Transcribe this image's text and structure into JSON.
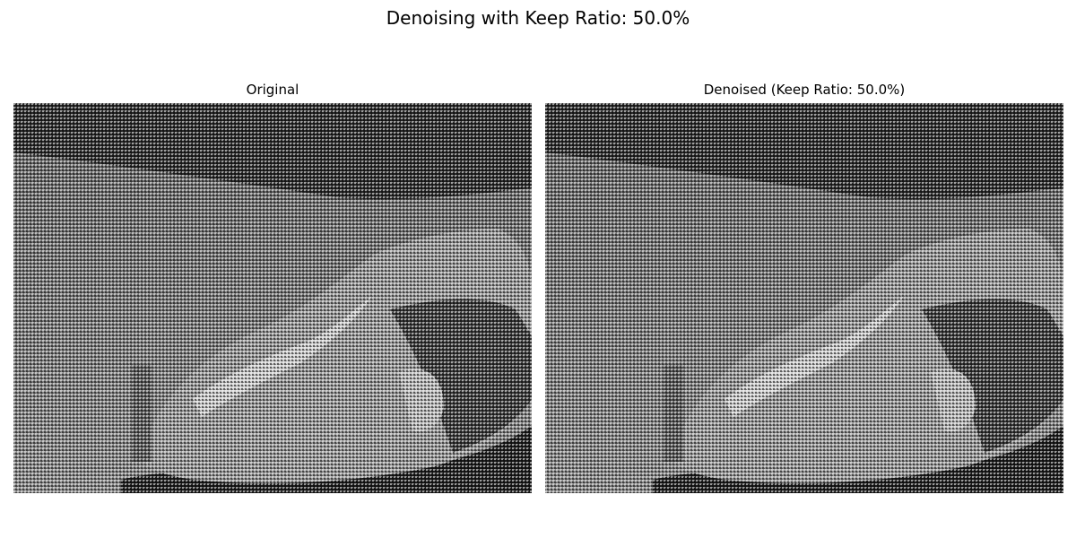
{
  "figure": {
    "title": "Denoising with Keep Ratio: 50.0%"
  },
  "panels": [
    {
      "title": "Original",
      "image": "grayscale-moon-rock-photo-with-dense-checker-noise"
    },
    {
      "title": "Denoised (Keep Ratio: 50.0%)",
      "image": "grayscale-moon-rock-photo-with-dense-checker-noise"
    }
  ]
}
